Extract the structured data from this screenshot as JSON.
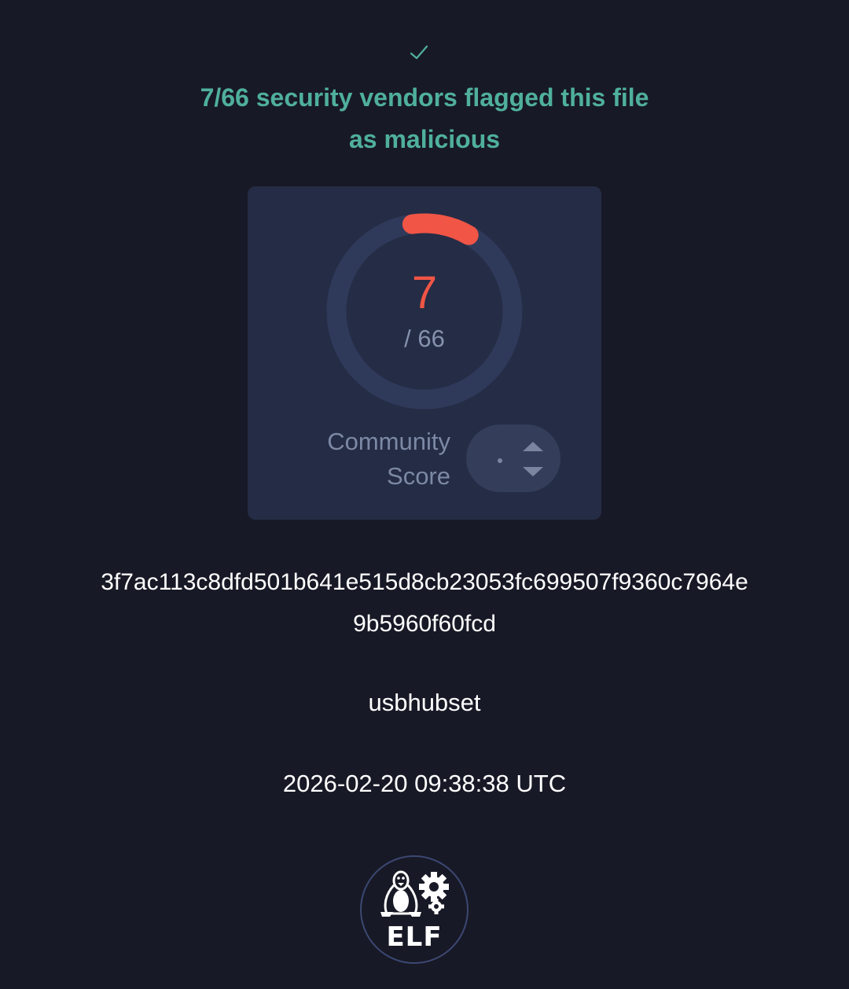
{
  "status": {
    "icon": "check-icon",
    "headline_line1": "7/66 security vendors flagged this file",
    "headline_line2": "as malicious",
    "color": "#4fb09c"
  },
  "detection": {
    "flagged": "7",
    "total_label": "/ 66",
    "flagged_fraction": 0.106,
    "arc_color": "#f05545"
  },
  "community_score": {
    "label_line1": "Community",
    "label_line2": "Score",
    "icons": [
      "dot-icon",
      "upvote-arrow-icon",
      "downvote-arrow-icon"
    ]
  },
  "file": {
    "hash_line1": "3f7ac113c8dfd501b641e515d8cb23053fc699507f9360c7964e",
    "hash_line2": "9b5960f60fcd",
    "name": "usbhubset",
    "date": "2026-02-20 09:38:38 UTC",
    "type_label": "ELF",
    "type_icon": "linux-penguin-gears-icon"
  }
}
